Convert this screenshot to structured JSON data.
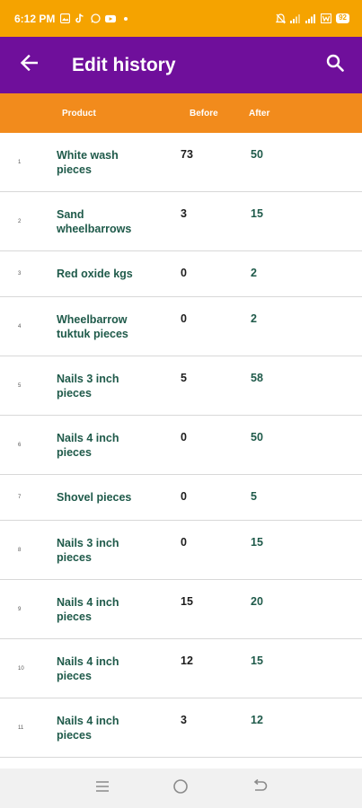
{
  "status_bar": {
    "time": "6:12 PM",
    "battery": "92"
  },
  "app_bar": {
    "title": "Edit history",
    "back_icon": "arrow-back-icon",
    "search_icon": "search-icon",
    "color": "#6f0f9b"
  },
  "table": {
    "header_color": "#f28b1c",
    "columns": {
      "product": "Product",
      "before": "Before",
      "after": "After"
    },
    "rows": [
      {
        "index": "1",
        "product": "White wash pieces",
        "before": "73",
        "after": "50"
      },
      {
        "index": "2",
        "product": "Sand wheelbarrows",
        "before": "3",
        "after": "15"
      },
      {
        "index": "3",
        "product": "Red oxide kgs",
        "before": "0",
        "after": "2"
      },
      {
        "index": "4",
        "product": "Wheelbarrow tuktuk pieces",
        "before": "0",
        "after": "2"
      },
      {
        "index": "5",
        "product": "Nails 3 inch pieces",
        "before": "5",
        "after": "58"
      },
      {
        "index": "6",
        "product": "Nails 4 inch pieces",
        "before": "0",
        "after": "50"
      },
      {
        "index": "7",
        "product": "Shovel pieces",
        "before": "0",
        "after": "5"
      },
      {
        "index": "8",
        "product": "Nails 3 inch pieces",
        "before": "0",
        "after": "15"
      },
      {
        "index": "9",
        "product": "Nails 4 inch pieces",
        "before": "15",
        "after": "20"
      },
      {
        "index": "10",
        "product": "Nails 4 inch pieces",
        "before": "12",
        "after": "15"
      },
      {
        "index": "11",
        "product": "Nails 4 inch pieces",
        "before": "3",
        "after": "12"
      }
    ]
  },
  "status_bar_color": "#f5a300"
}
